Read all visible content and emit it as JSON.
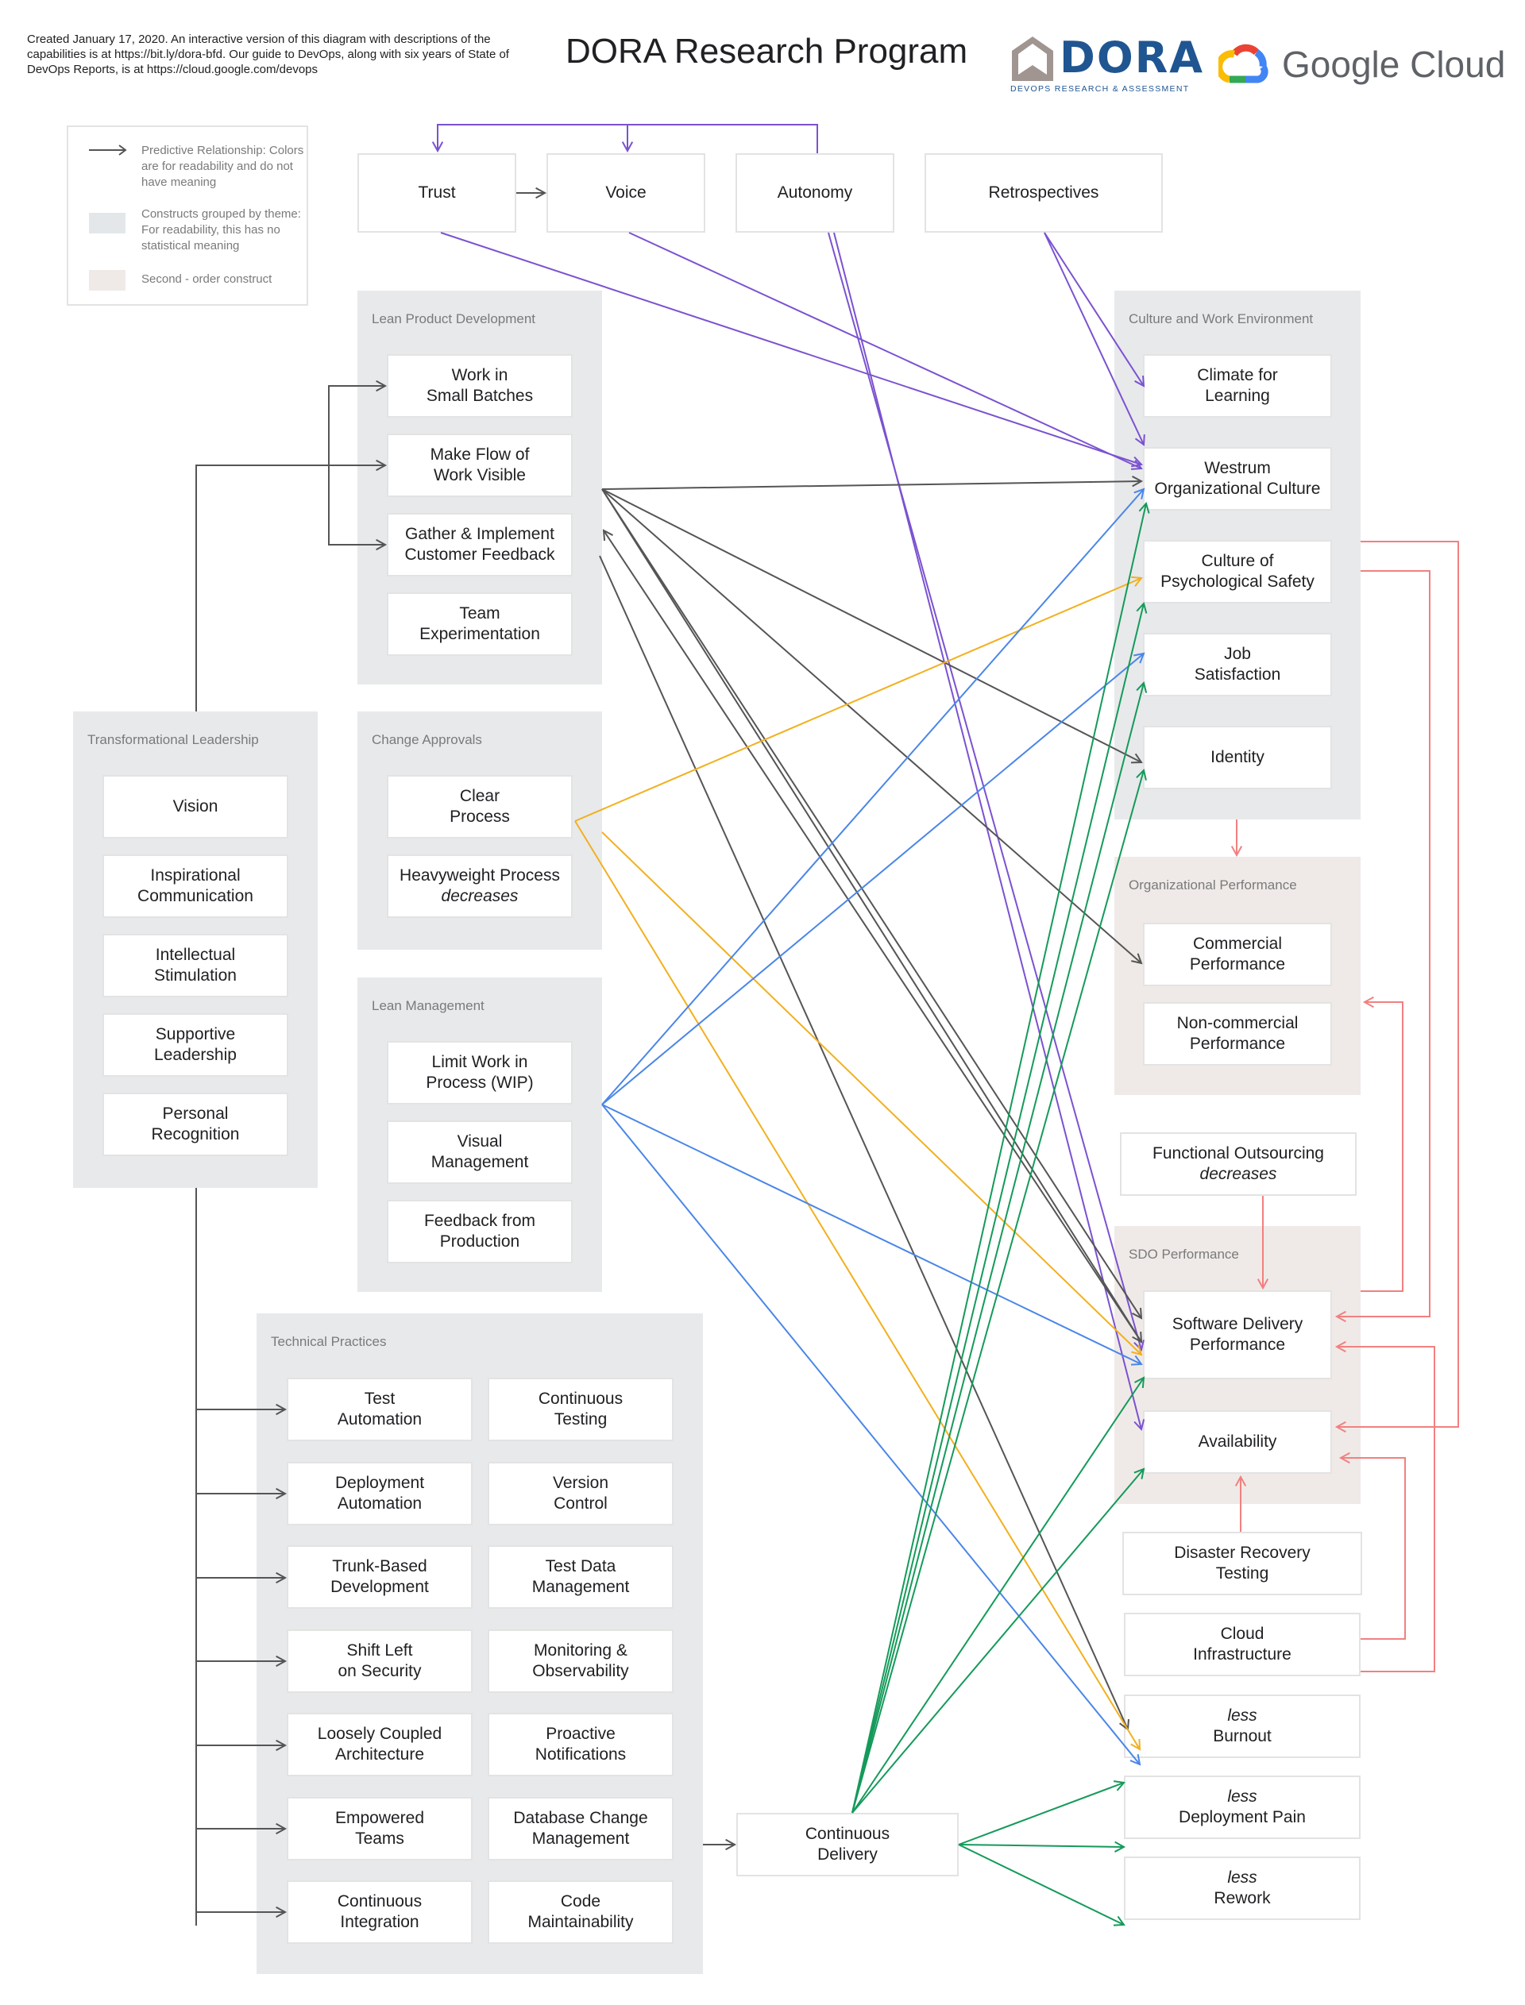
{
  "header": {
    "intro_text": "Created January 17, 2020. An interactive version of this diagram with descriptions of the capabilities is at https://bit.ly/dora-bfd. Our guide to DevOps, along with six years of State of DevOps Reports, is at https://cloud.google.com/devops",
    "title": "DORA Research Program",
    "dora_logo_word": "DORA",
    "dora_logo_sub": "DEVOPS RESEARCH & ASSESSMENT",
    "gc_logo_word": "Google Cloud"
  },
  "legend": {
    "arrow_text": "Predictive Relationship: Colors are for readability and do not have meaning",
    "group_text": "Constructs grouped by theme: For readability, this has no statistical meaning",
    "second_order_text": "Second - order construct",
    "group_color": "#e4e7e9",
    "second_order_color": "#efeae8"
  },
  "colors": {
    "purple": "#7b52d0",
    "gray": "#555555",
    "blue": "#4a86e8",
    "yellow": "#f2b01e",
    "green": "#159a5a",
    "red": "#f28080",
    "group_bg": "#e8e9eb",
    "second_order_bg": "#efeae8"
  },
  "top_nodes": {
    "trust": "Trust",
    "voice": "Voice",
    "autonomy": "Autonomy",
    "retrospectives": "Retrospectives"
  },
  "lean_product": {
    "label": "Lean Product Development",
    "items": [
      [
        "Work in",
        "Small Batches"
      ],
      [
        "Make Flow of",
        "Work Visible"
      ],
      [
        "Gather & Implement",
        "Customer Feedback"
      ],
      [
        "Team",
        "Experimentation"
      ]
    ]
  },
  "transformational": {
    "label": "Transformational Leadership",
    "items": [
      [
        "Vision",
        ""
      ],
      [
        "Inspirational",
        "Communication"
      ],
      [
        "Intellectual",
        "Stimulation"
      ],
      [
        "Supportive",
        "Leadership"
      ],
      [
        "Personal",
        "Recognition"
      ]
    ]
  },
  "change_approvals": {
    "label": "Change Approvals",
    "items": [
      [
        "Clear",
        "Process"
      ],
      [
        "Heavyweight Process",
        "decreases"
      ]
    ]
  },
  "lean_management": {
    "label": "Lean Management",
    "items": [
      [
        "Limit Work in",
        "Process (WIP)"
      ],
      [
        "Visual",
        "Management"
      ],
      [
        "Feedback from",
        "Production"
      ]
    ]
  },
  "technical": {
    "label": "Technical Practices",
    "items": [
      [
        "Test",
        "Automation"
      ],
      [
        "Continuous",
        "Testing"
      ],
      [
        "Deployment",
        "Automation"
      ],
      [
        "Version",
        "Control"
      ],
      [
        "Trunk-Based",
        "Development"
      ],
      [
        "Test Data",
        "Management"
      ],
      [
        "Shift Left",
        "on Security"
      ],
      [
        "Monitoring &",
        "Observability"
      ],
      [
        "Loosely Coupled",
        "Architecture"
      ],
      [
        "Proactive",
        "Notifications"
      ],
      [
        "Empowered",
        "Teams"
      ],
      [
        "Database Change",
        "Management"
      ],
      [
        "Continuous",
        "Integration"
      ],
      [
        "Code",
        "Maintainability"
      ]
    ]
  },
  "continuous_delivery": [
    "Continuous",
    "Delivery"
  ],
  "culture": {
    "label": "Culture and Work Environment",
    "items": [
      [
        "Climate for",
        "Learning"
      ],
      [
        "Westrum",
        "Organizational Culture"
      ],
      [
        "Culture of",
        "Psychological Safety"
      ],
      [
        "Job",
        "Satisfaction"
      ],
      [
        "Identity",
        ""
      ]
    ]
  },
  "org_performance": {
    "label": "Organizational Performance",
    "items": [
      [
        "Commercial",
        "Performance"
      ],
      [
        "Non-commercial",
        "Performance"
      ]
    ]
  },
  "functional_outsourcing": [
    "Functional Outsourcing",
    "decreases"
  ],
  "sdo": {
    "label": "SDO Performance",
    "items": [
      [
        "Software Delivery",
        "Performance"
      ],
      [
        "Availability",
        ""
      ]
    ]
  },
  "disaster_recovery": [
    "Disaster Recovery",
    "Testing"
  ],
  "cloud": [
    "Cloud",
    "Infrastructure"
  ],
  "outcomes": [
    [
      "less",
      "Burnout"
    ],
    [
      "less",
      "Deployment Pain"
    ],
    [
      "less",
      "Rework"
    ]
  ]
}
